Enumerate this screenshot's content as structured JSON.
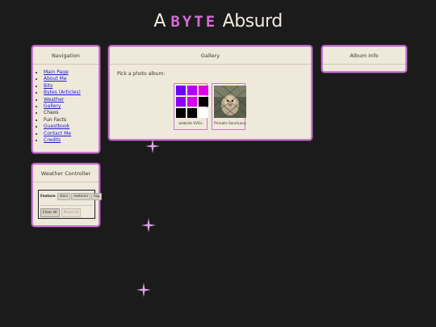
{
  "site": {
    "title_prefix": "A",
    "title_brand": "BYTE",
    "title_suffix": "Absurd"
  },
  "navigation": {
    "title": "Navigation",
    "items": [
      {
        "label": "Main Page",
        "link": true
      },
      {
        "label": "About Me",
        "link": true
      },
      {
        "label": "Bits",
        "link": true
      },
      {
        "label": "Bytes (Articles)",
        "link": true
      },
      {
        "label": "Weather",
        "link": true
      },
      {
        "label": "Gallery",
        "link": true
      },
      {
        "label": "Chaos",
        "link": false
      },
      {
        "label": "Fun Facts",
        "link": false
      },
      {
        "label": "Guestbook",
        "link": true
      },
      {
        "label": "Contact Me",
        "link": true
      },
      {
        "label": "Credits",
        "link": true
      }
    ]
  },
  "gallery": {
    "title": "Gallery",
    "prompt": "Pick a photo album:",
    "albums": [
      {
        "label": "website SVGs",
        "thumb": "svg-color-grid"
      },
      {
        "label": "Primate Sanctuary",
        "thumb": "monkey-photo"
      }
    ],
    "svg_grid_colors": [
      "#6a00ff",
      "#b200ff",
      "#e000e6",
      "#8a00ff",
      "#d400f0",
      "#000000",
      "#000000",
      "#000000",
      "#ffffff"
    ]
  },
  "album_info": {
    "title": "Album Info"
  },
  "weather_controller": {
    "title": "Weather Controller",
    "feature_label": "Feature",
    "features": [
      "stars",
      "meteors",
      "fog"
    ],
    "clear_all": "Clear all",
    "reset_all": "Reset all"
  },
  "colors": {
    "accent": "#c879d2",
    "background": "#1c1b1b",
    "panel": "#efe9dc"
  }
}
